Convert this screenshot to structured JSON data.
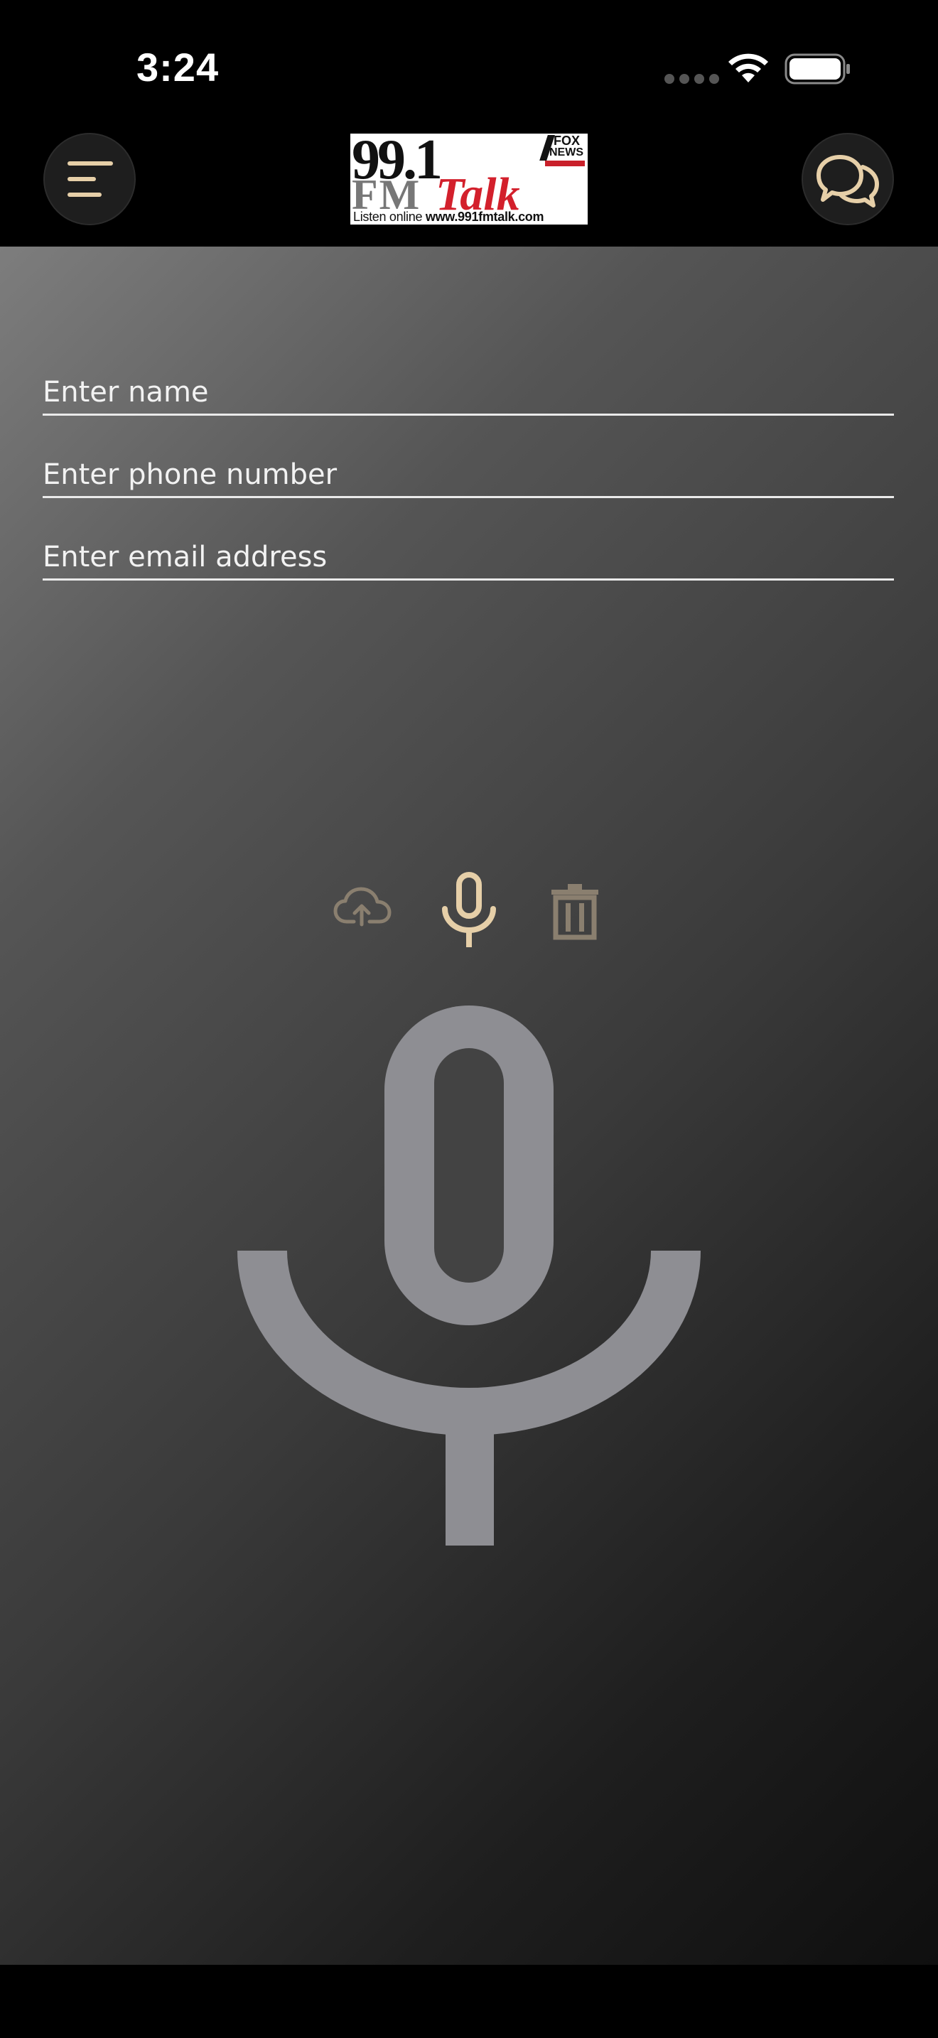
{
  "status_bar": {
    "time": "3:24",
    "icons": [
      "signal-dots-icon",
      "wifi-icon",
      "battery-icon"
    ]
  },
  "header": {
    "menu_icon": "menu-icon",
    "chat_icon": "chat-bubbles-icon",
    "logo": {
      "number": "99.1",
      "fm": "FM",
      "talk": "Talk",
      "network_line1": "FOX",
      "network_line2": "NEWS",
      "url_prefix": "Listen online ",
      "url": "www.991fmtalk.com"
    }
  },
  "form": {
    "name_placeholder": "Enter name",
    "name_value": "",
    "phone_placeholder": "Enter phone number",
    "phone_value": "",
    "email_placeholder": "Enter email address",
    "email_value": ""
  },
  "recorder": {
    "main_icon": "microphone-icon",
    "tools": [
      "cloud-upload-icon",
      "microphone-icon",
      "trash-icon"
    ]
  },
  "colors": {
    "accent": "#e6cfa8",
    "accent_muted": "#8a7f6f",
    "mic_gray": "#8e8e93",
    "header_bg": "#000000"
  }
}
